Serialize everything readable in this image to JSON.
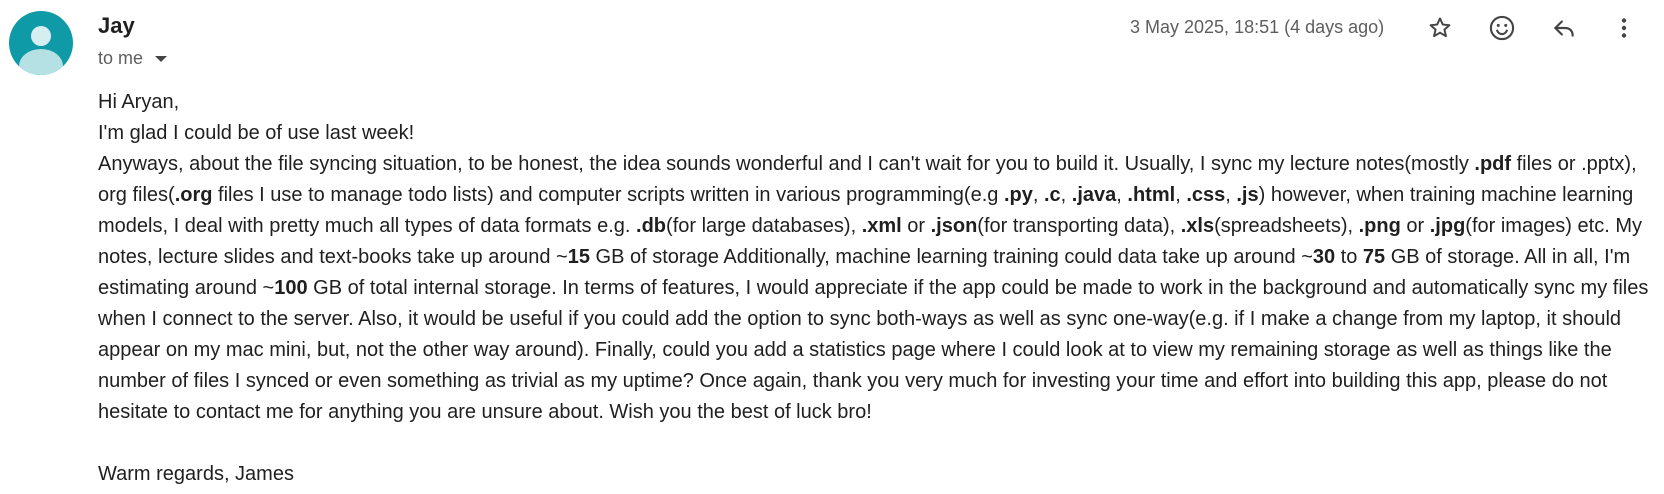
{
  "email": {
    "sender_name": "Jay",
    "recipient_label": "to me",
    "timestamp": "3 May 2025, 18:51 (4 days ago)",
    "greeting": "Hi Aryan,",
    "line1": "I'm glad I could be of use last week!",
    "body": {
      "s01": "Anyways, about the file syncing situation, to be honest, the idea sounds wonderful and I can't wait for you to build it. Usually, I sync my lecture notes(mostly ",
      "b01": ".pdf",
      "s02": " files or .pptx), org files(",
      "b02": ".org",
      "s03": " files I use to manage todo lists) and computer scripts written in various programming(e.g ",
      "b03": ".py",
      "s04": ", ",
      "b04": ".c",
      "s05": ", ",
      "b05": ".java",
      "s06": ", ",
      "b06": ".html",
      "s07": ", ",
      "b07": ".css",
      "s08": ", ",
      "b08": ".js",
      "s09": ") however, when training machine learning models, I deal with pretty much all types of data formats e.g. ",
      "b09": ".db",
      "s10": "(for large databases), ",
      "b10": ".xml",
      "s11": " or ",
      "b11": ".json",
      "s12": "(for transporting data), ",
      "b12": ".xls",
      "s13": "(spreadsheets), ",
      "b13": ".png",
      "s14": " or ",
      "b14": ".jpg",
      "s15": "(for images) etc. My notes, lecture slides and text-books take up around ~",
      "b15": "15",
      "s16": " GB of storage Additionally, machine learning training could data take up around ~",
      "b16": "30",
      "s17": " to ",
      "b17": "75",
      "s18": " GB of storage. All in all, I'm estimating around ~",
      "b18": "100",
      "s19": " GB of total internal storage. In terms of features, I would appreciate if the app could be made to work in the background and automatically sync my files when I connect to the server. Also, it would be useful if you could add the option to sync both-ways as well as sync one-way(e.g. if I make a change from my laptop, it should appear on my mac mini, but, not the other way around). Finally, could you add a statistics page where I could look at to view my remaining storage as well as things like the number of files I synced or even something as trivial as my uptime? Once again, thank you very much for investing your time and effort into building this app, please do not hesitate to contact me for anything you are unsure about. Wish you the best of luck bro!"
    },
    "signoff": "Warm regards, James"
  },
  "icons": {
    "avatar": "person-avatar",
    "star": "star-icon",
    "emoji": "emoji-icon",
    "reply": "reply-icon",
    "more": "more-vert-icon"
  },
  "colors": {
    "avatar_bg": "#0e9aa7",
    "text": "#1f1f1f",
    "muted": "#5e5e5e"
  }
}
